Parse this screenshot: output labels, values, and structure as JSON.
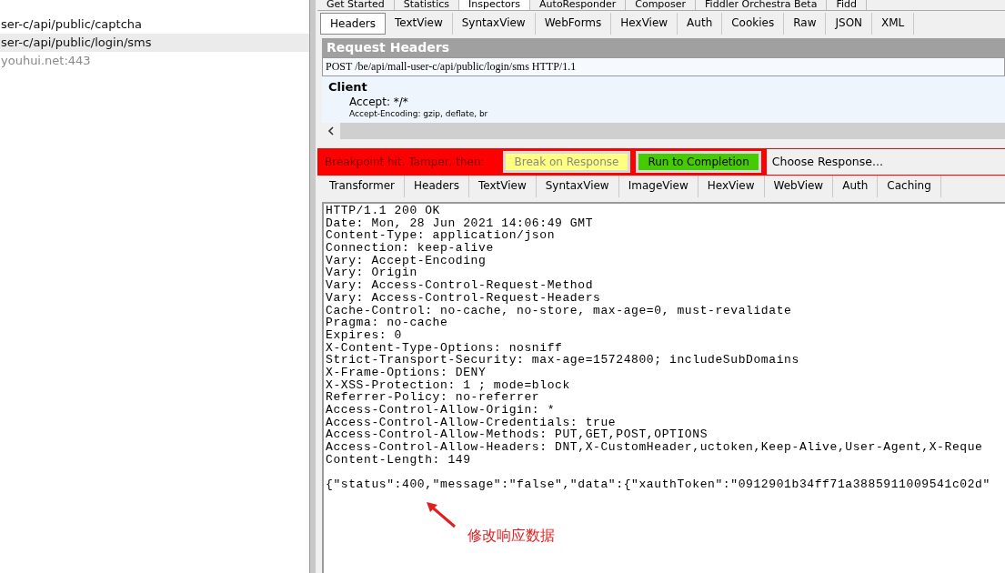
{
  "session_list": {
    "rows": [
      {
        "text": "ser-c/api/public/captcha",
        "selected": false,
        "muted": false
      },
      {
        "text": "ser-c/api/public/login/sms",
        "selected": true,
        "muted": false
      },
      {
        "text": "youhui.net:443",
        "selected": false,
        "muted": true
      }
    ]
  },
  "main_tabs": [
    {
      "label": "Get Started",
      "selected": false
    },
    {
      "label": "Statistics",
      "selected": false
    },
    {
      "label": "Inspectors",
      "selected": true
    },
    {
      "label": "AutoResponder",
      "selected": false
    },
    {
      "label": "Composer",
      "selected": false
    },
    {
      "label": "Fiddler Orchestra Beta",
      "selected": false
    },
    {
      "label": "Fidd",
      "selected": false
    }
  ],
  "request_tabs": [
    {
      "label": "Headers",
      "selected": true
    },
    {
      "label": "TextView",
      "selected": false
    },
    {
      "label": "SyntaxView",
      "selected": false
    },
    {
      "label": "WebForms",
      "selected": false
    },
    {
      "label": "HexView",
      "selected": false
    },
    {
      "label": "Auth",
      "selected": false
    },
    {
      "label": "Cookies",
      "selected": false
    },
    {
      "label": "Raw",
      "selected": false
    },
    {
      "label": "JSON",
      "selected": false
    },
    {
      "label": "XML",
      "selected": false
    }
  ],
  "request_headers": {
    "title": "Request Headers",
    "request_line": "POST /be/api/mall-user-c/api/public/login/sms HTTP/1.1",
    "group": "Client",
    "items": [
      "Accept: */*",
      "Accept-Encoding: gzip, deflate, br"
    ]
  },
  "breakpoint_bar": {
    "message": "Breakpoint hit. Tamper, then:",
    "buttons": [
      {
        "label": "Break on Response",
        "disabled": true
      },
      {
        "label": "Run to Completion",
        "disabled": false
      }
    ],
    "choose_response": "Choose Response..."
  },
  "response_tabs": [
    {
      "label": "Transformer",
      "selected": false
    },
    {
      "label": "Headers",
      "selected": false
    },
    {
      "label": "TextView",
      "selected": false
    },
    {
      "label": "SyntaxView",
      "selected": false
    },
    {
      "label": "ImageView",
      "selected": false
    },
    {
      "label": "HexView",
      "selected": false
    },
    {
      "label": "WebView",
      "selected": false
    },
    {
      "label": "Auth",
      "selected": false
    },
    {
      "label": "Caching",
      "selected": false
    }
  ],
  "response_body": {
    "lines": [
      "HTTP/1.1 200 OK",
      "Date: Mon, 28 Jun 2021 14:06:49 GMT",
      "Content-Type: application/json",
      "Connection: keep-alive",
      "Vary: Accept-Encoding",
      "Vary: Origin",
      "Vary: Access-Control-Request-Method",
      "Vary: Access-Control-Request-Headers",
      "Cache-Control: no-cache, no-store, max-age=0, must-revalidate",
      "Pragma: no-cache",
      "Expires: 0",
      "X-Content-Type-Options: nosniff",
      "Strict-Transport-Security: max-age=15724800; includeSubDomains",
      "X-Frame-Options: DENY",
      "X-XSS-Protection: 1 ; mode=block",
      "Referrer-Policy: no-referrer",
      "Access-Control-Allow-Origin: *",
      "Access-Control-Allow-Credentials: true",
      "Access-Control-Allow-Methods: PUT,GET,POST,OPTIONS",
      "Access-Control-Allow-Headers: DNT,X-CustomHeader,uctoken,Keep-Alive,User-Agent,X-Reque",
      "Content-Length: 149"
    ],
    "payload_lines": [
      "{\"status\":400,\"message\":\"false\",\"data\":{\"xauthToken\":\"0912901b34ff71a3885911009541c02d\""
    ]
  },
  "annotation": {
    "text": "修改响应数据"
  }
}
